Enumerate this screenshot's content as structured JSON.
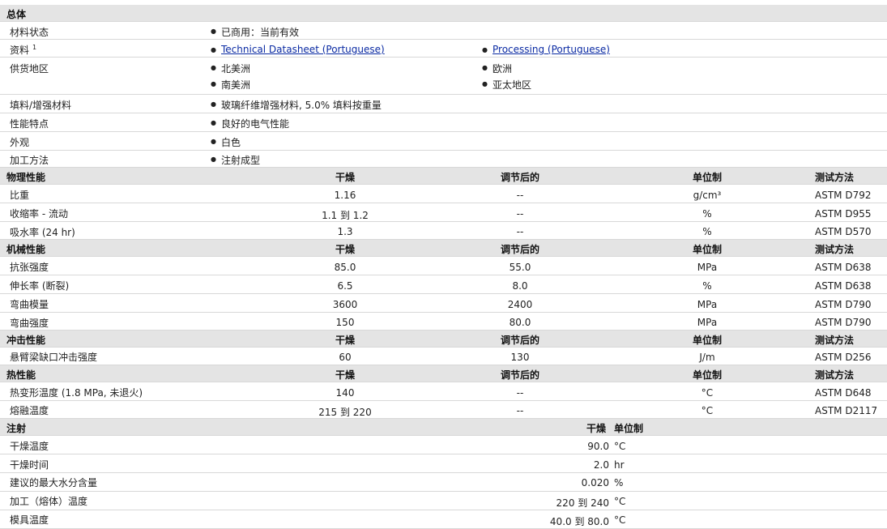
{
  "overview": {
    "title": "总体",
    "status_label": "材料状态",
    "status_value": "已商用：当前有效",
    "docs_label": "资料",
    "docs_sup": "1",
    "doc_link_1": "Technical Datasheet (Portuguese)",
    "doc_link_2": "Processing (Portuguese)",
    "region_label": "供货地区",
    "regions": [
      "北美洲",
      "欧洲",
      "南美洲",
      "亚太地区"
    ],
    "filler_label": "填料/增强材料",
    "filler_value": "玻璃纤维增强材料, 5.0% 填料按重量",
    "features_label": "性能特点",
    "features_value": "良好的电气性能",
    "appearance_label": "外观",
    "appearance_value": "白色",
    "process_label": "加工方法",
    "process_value": "注射成型"
  },
  "col_headers": {
    "dry": "干燥",
    "conditioned": "调节后的",
    "unit": "单位制",
    "method": "测试方法"
  },
  "physical": {
    "title": "物理性能",
    "rows": [
      {
        "name": "比重",
        "dry": "1.16",
        "cond": "--",
        "unit": "g/cm³",
        "method": "ASTM D792"
      },
      {
        "name": "收缩率 - 流动",
        "dry": "1.1 到 1.2",
        "cond": "--",
        "unit": "%",
        "method": "ASTM D955"
      },
      {
        "name": "吸水率 (24 hr)",
        "dry": "1.3",
        "cond": "--",
        "unit": "%",
        "method": "ASTM D570"
      }
    ]
  },
  "mechanical": {
    "title": "机械性能",
    "rows": [
      {
        "name": "抗张强度",
        "dry": "85.0",
        "cond": "55.0",
        "unit": "MPa",
        "method": "ASTM D638"
      },
      {
        "name": "伸长率 (断裂)",
        "dry": "6.5",
        "cond": "8.0",
        "unit": "%",
        "method": "ASTM D638"
      },
      {
        "name": "弯曲模量",
        "dry": "3600",
        "cond": "2400",
        "unit": "MPa",
        "method": "ASTM D790"
      },
      {
        "name": "弯曲强度",
        "dry": "150",
        "cond": "80.0",
        "unit": "MPa",
        "method": "ASTM D790"
      }
    ]
  },
  "impact": {
    "title": "冲击性能",
    "rows": [
      {
        "name": "悬臂梁缺口冲击强度",
        "dry": "60",
        "cond": "130",
        "unit": "J/m",
        "method": "ASTM D256"
      }
    ]
  },
  "thermal": {
    "title": "热性能",
    "rows": [
      {
        "name": "热变形温度 (1.8 MPa, 未退火)",
        "dry": "140",
        "cond": "--",
        "unit": "°C",
        "method": "ASTM D648"
      },
      {
        "name": "熔融温度",
        "dry": "215 到 220",
        "cond": "--",
        "unit": "°C",
        "method": "ASTM D2117"
      }
    ]
  },
  "injection": {
    "title": "注射",
    "h_dry": "干燥",
    "h_unit": "单位制",
    "rows": [
      {
        "name": "干燥温度",
        "value": "90.0",
        "unit": "°C"
      },
      {
        "name": "干燥时间",
        "value": "2.0",
        "unit": "hr"
      },
      {
        "name": "建议的最大水分含量",
        "value": "0.020",
        "unit": "%"
      },
      {
        "name": "加工（熔体）温度",
        "value": "220 到 240",
        "unit": "°C"
      },
      {
        "name": "模具温度",
        "value": "40.0 到 80.0",
        "unit": "°C"
      }
    ]
  }
}
